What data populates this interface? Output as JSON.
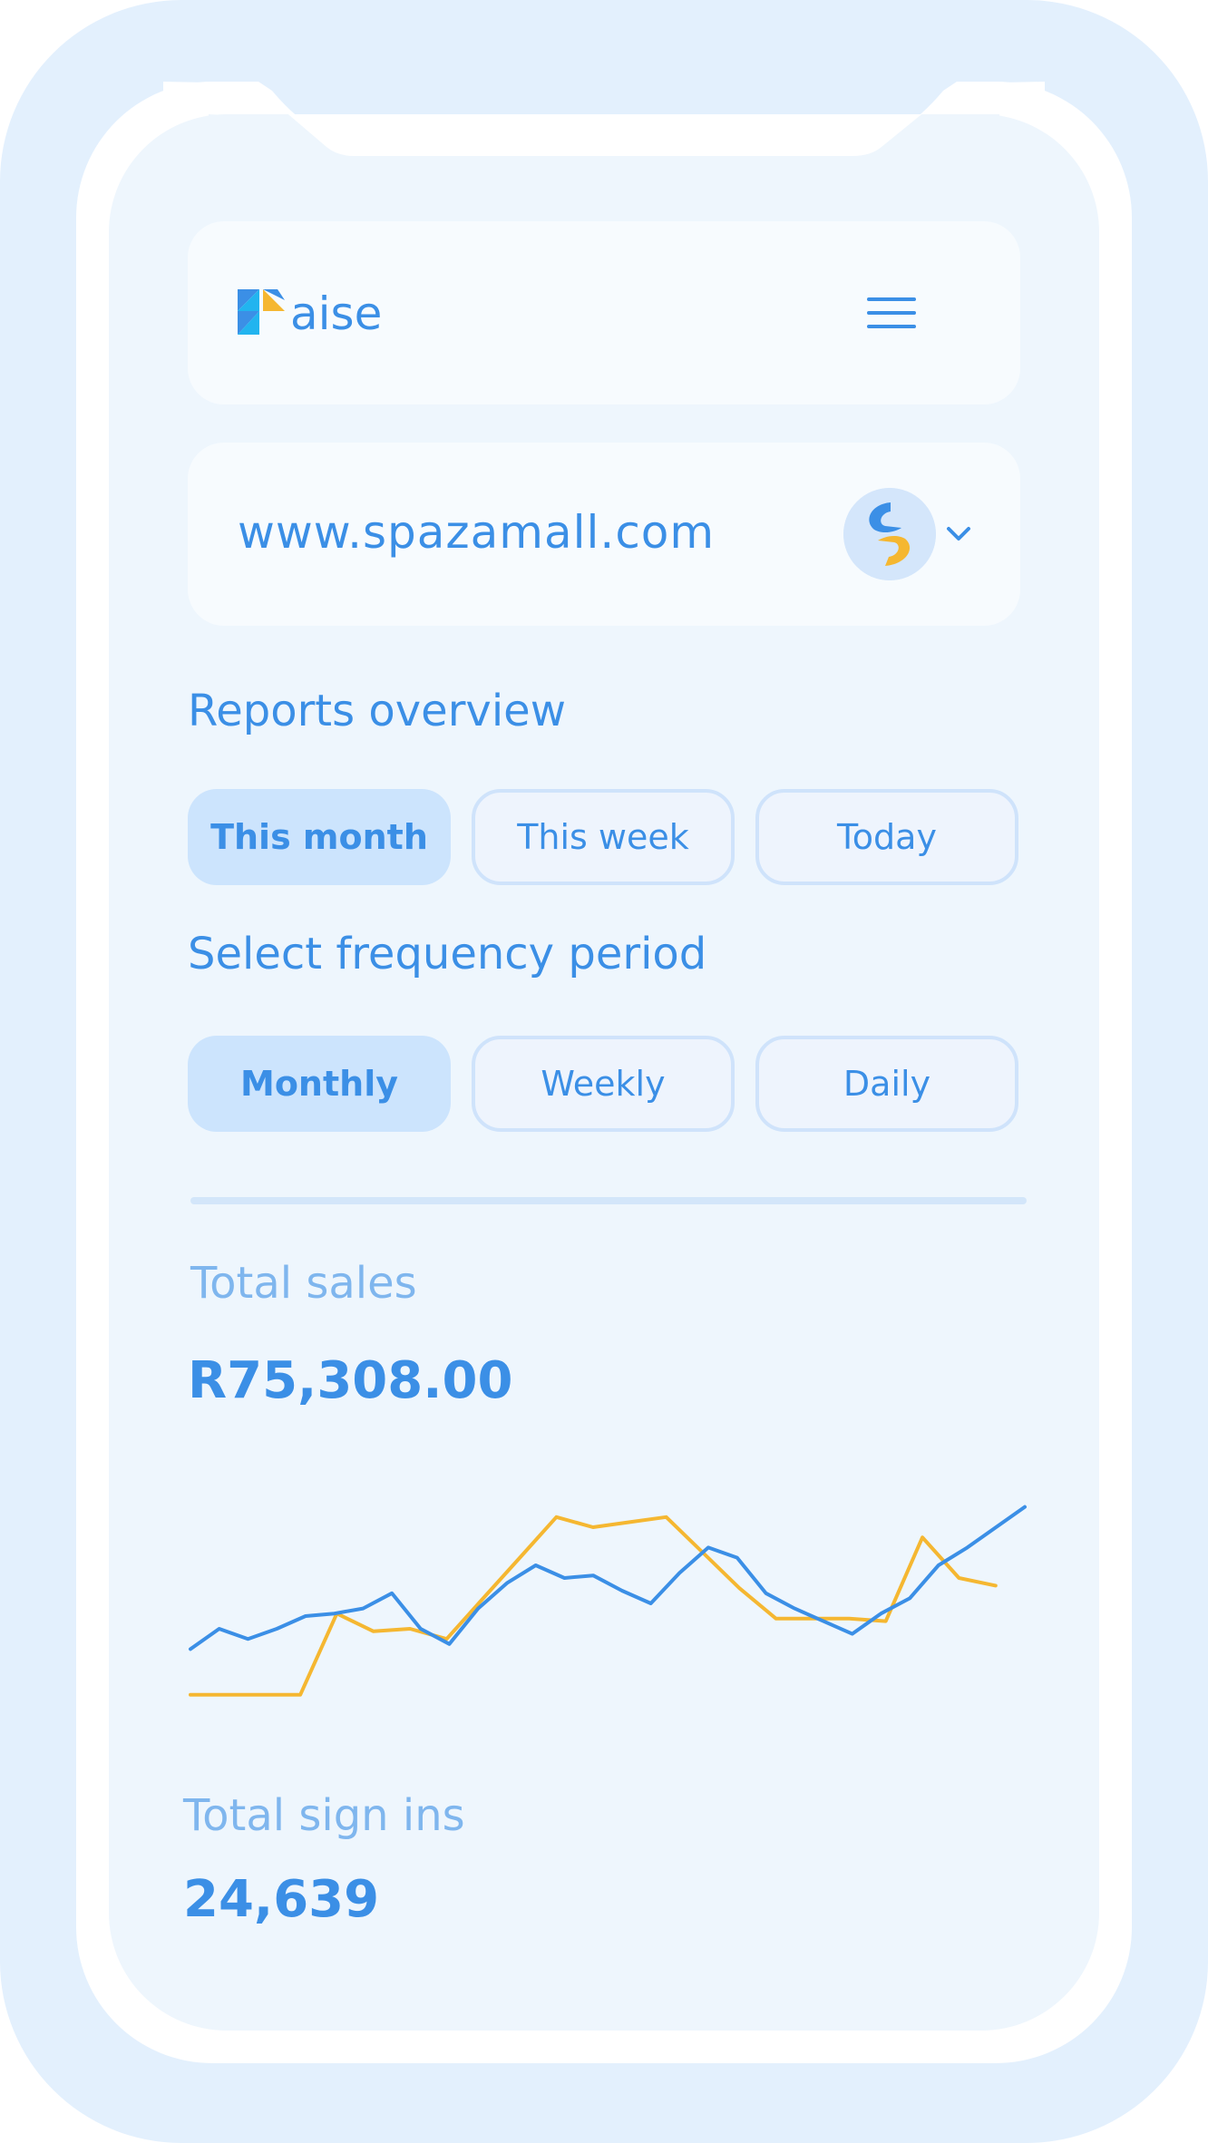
{
  "header": {
    "logo_text": "aise",
    "logo_icon": "paise-logo-mark",
    "menu_icon": "hamburger-menu-icon"
  },
  "site": {
    "url": "www.spazamall.com",
    "avatar_icon": "store-avatar-icon",
    "dropdown_icon": "chevron-down-icon"
  },
  "reports": {
    "title": "Reports overview",
    "options": [
      {
        "label": "This month",
        "active": true
      },
      {
        "label": "This week",
        "active": false
      },
      {
        "label": "Today",
        "active": false
      }
    ]
  },
  "frequency": {
    "title": "Select frequency period",
    "options": [
      {
        "label": "Monthly",
        "active": true
      },
      {
        "label": "Weekly",
        "active": false
      },
      {
        "label": "Daily",
        "active": false
      }
    ]
  },
  "total_sales": {
    "label": "Total sales",
    "value": "R75,308.00"
  },
  "total_sign_ins": {
    "label": "Total sign ins",
    "value": "24,639"
  },
  "colors": {
    "accent": "#3b8fe6",
    "secondary": "#f5b731",
    "muted_label": "#7fb6ee"
  },
  "chart_data": {
    "type": "line",
    "title": "",
    "xlabel": "",
    "ylabel": "",
    "grid": false,
    "legend": "none",
    "x": [
      0,
      1,
      2,
      3,
      4,
      5,
      6,
      7,
      8,
      9,
      10,
      11,
      12,
      13,
      14,
      15,
      16,
      17,
      18,
      19,
      20,
      21,
      22,
      23,
      24,
      25,
      26,
      27,
      28,
      29,
      30
    ],
    "ylim": [
      0,
      100
    ],
    "series": [
      {
        "color": "#f5b731",
        "values": [
          4,
          4,
          4,
          4,
          36,
          29,
          30,
          26,
          42,
          58,
          74,
          70,
          72,
          74,
          60,
          46,
          34,
          34,
          34,
          33,
          66,
          50,
          47
        ]
      },
      {
        "color": "#3b8fe6",
        "values": [
          22,
          30,
          26,
          30,
          35,
          36,
          38,
          44,
          30,
          24,
          38,
          48,
          55,
          50,
          51,
          45,
          40,
          52,
          62,
          58,
          44,
          38,
          33,
          28,
          36,
          42,
          55,
          62,
          70,
          78
        ]
      }
    ]
  }
}
